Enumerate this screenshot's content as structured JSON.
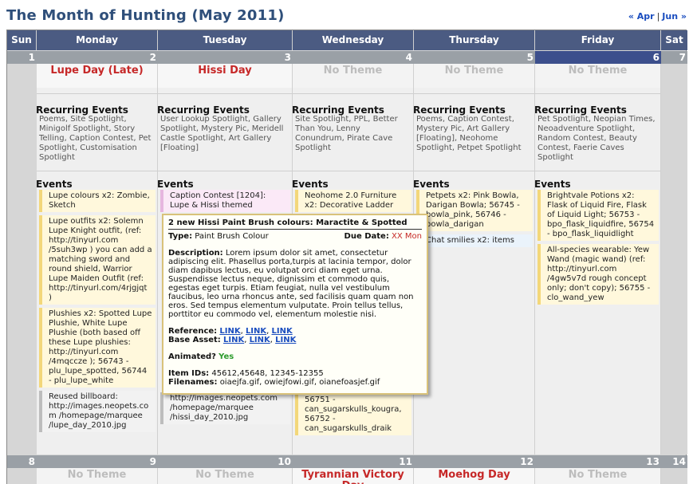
{
  "title": "The Month of Hunting (May 2011)",
  "nav": {
    "prev": "« Apr",
    "separator": "|",
    "next": "Jun »"
  },
  "weekdays": [
    "Sun",
    "Monday",
    "Tuesday",
    "Wednesday",
    "Thursday",
    "Friday",
    "Sat"
  ],
  "week1": {
    "sun_date": "1",
    "sat_date": "7",
    "days": [
      {
        "date": "2",
        "theme": "Lupe Day (Late)",
        "recurring_title": "Recurring Events",
        "recurring": "Poems, Site Spotlight, Minigolf Spotlight, Story Telling, Caption Contest, Pet Spotlight, Customisation Spotlight",
        "events_title": "Events",
        "events": [
          "Lupe colours x2: Zombie, Sketch",
          "Lupe outfits x2: Solemn Lupe Knight outfit, (ref: http://tinyurl.com /5suh3wp ) you can add a matching sword and round shield, Warrior Lupe Maiden Outfit (ref: http://tinyurl.com/4rjgjqt )",
          "Plushies x2: Spotted Lupe Plushie, White Lupe Plushie (both based off these Lupe plushies: http://tinyurl.com /4mqccze ); 56743 - plu_lupe_spotted, 56744 - plu_lupe_white",
          "Reused billboard: http://images.neopets.com /homepage/marquee /lupe_day_2010.jpg"
        ]
      },
      {
        "date": "3",
        "theme": "Hissi Day",
        "recurring_title": "Recurring Events",
        "recurring": "User Lookup Spotlight, Gallery Spotlight, Mystery Pic, Meridell Castle Spotlight, Art Gallery [Floating]",
        "events_title": "Events",
        "events": [
          "Caption Contest [1204]: Lupe & Hissi themed",
          "http://images.neopets.com /homepage/marquee /hissi_day_2010.jpg"
        ]
      },
      {
        "date": "4",
        "theme": "No Theme",
        "recurring_title": "Recurring Events",
        "recurring": "Site Spotlight, PPL, Better Than You, Lenny Conundrum, Pirate Cave Spotlight",
        "events_title": "Events",
        "events": [
          "Neohome 2.0 Furniture x2: Decorative Ladder",
          "/47bmlay Cinco De Mayo; 56751 - can_sugarskulls_kougra, 56752 - can_sugarskulls_draik"
        ]
      },
      {
        "date": "5",
        "theme": "No Theme",
        "recurring_title": "Recurring Events",
        "recurring": "Poems, Caption Contest, Mystery Pic, Art Gallery [Floating], Neohome Spotlight, Petpet Spotlight",
        "events_title": "Events",
        "events": [
          "Petpets x2: Pink Bowla, Darigan Bowla; 56745 - bowla_pink, 56746 - bowla_darigan",
          "Chat smilies x2: items"
        ]
      },
      {
        "date": "6",
        "theme": "No Theme",
        "recurring_title": "Recurring Events",
        "recurring": "Pet Spotlight, Neopian Times, Neoadventure Spotlight, Random Contest, Beauty Contest, Faerie Caves Spotlight",
        "events_title": "Events",
        "events": [
          "Brightvale Potions x2: Flask of Liquid Fire, Flask of Liquid Light; 56753 - bpo_flask_liquidfire, 56754 - bpo_flask_liquidlight",
          "All-species wearable: Yew Wand (magic wand) (ref: http://tinyurl.com /4gw5v7d rough concept only; don't copy); 56755 - clo_wand_yew"
        ]
      }
    ]
  },
  "week2": {
    "sun_date": "8",
    "sat_date": "14",
    "days": [
      {
        "date": "9",
        "theme": "No Theme"
      },
      {
        "date": "10",
        "theme": "No Theme"
      },
      {
        "date": "11",
        "theme": "Tyrannian Victory Day"
      },
      {
        "date": "12",
        "theme": "Moehog Day"
      },
      {
        "date": "13",
        "theme": "No Theme"
      }
    ]
  },
  "tooltip": {
    "title": "2 new Hissi Paint Brush colours: Maractite & Spotted",
    "type_label": "Type:",
    "type_value": "Paint Brush Colour",
    "due_label": "Due Date:",
    "due_value": "XX Mon",
    "desc_label": "Description:",
    "desc_value": "Lorem ipsum dolor sit amet, consectetur adipiscing elit. Phasellus porta,turpis at lacinia tempor, dolor diam dapibus lectus, eu volutpat orci diam eget urna. Suspendisse lectus neque, dignissim et commodo quis, egestas eget turpis. Etiam feugiat, nulla vel vestibulum faucibus, leo urna rhoncus ante, sed facilisis quam quam non eros. Sed tempus elementum vulputate. Proin tellus tellus, porttitor eu commodo vel, elementum molestie nisi.",
    "reference_label": "Reference:",
    "reference_links": [
      "LINK",
      "LINK",
      "LINK"
    ],
    "base_asset_label": "Base Asset:",
    "base_asset_links": [
      "LINK",
      "LINK",
      "LINK"
    ],
    "animated_label": "Animated?",
    "animated_value": "Yes",
    "item_ids_label": "Item IDs:",
    "item_ids_value": "45612,45648, 12345-12355",
    "filenames_label": "Filenames:",
    "filenames_value": "oiaejfa.gif, owiejfowi.gif, oianefoasjef.gif"
  },
  "colors": {
    "title": "#2f4f7a",
    "header": "#4b5b82",
    "today": "#3c4f8c",
    "theme_red": "#c62828",
    "event_yellow": "#fff8dc",
    "event_pink": "#fbe9f7"
  }
}
